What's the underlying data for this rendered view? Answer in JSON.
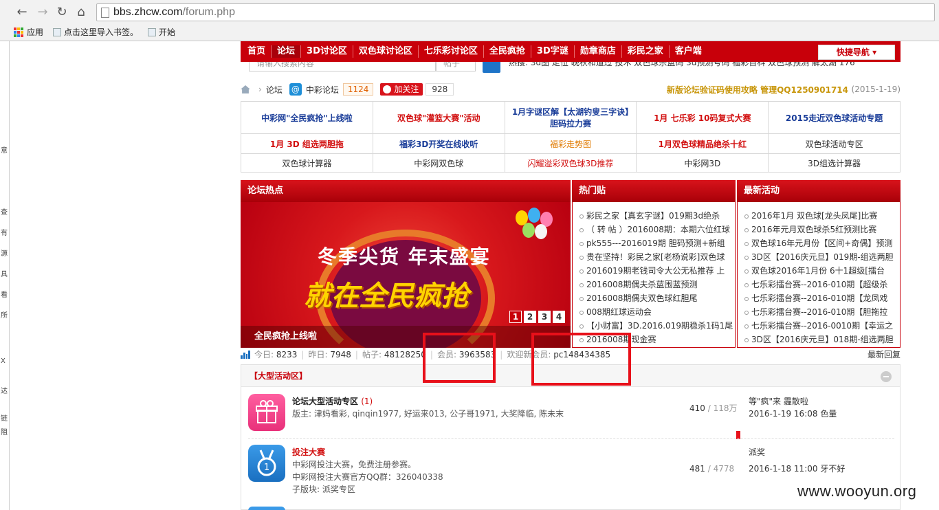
{
  "browser": {
    "back_icon": "back-arrow-icon",
    "url_host": "bbs.zhcw.com",
    "url_path": "/forum.php",
    "bookmarks": [
      "应用",
      "点击这里导入书签。",
      "开始"
    ]
  },
  "site_nav": {
    "items": [
      "首页",
      "论坛",
      "3D讨论区",
      "双色球讨论区",
      "七乐彩讨论区",
      "全民疯抢",
      "3D字谜",
      "勋章商店",
      "彩民之家",
      "客户端"
    ],
    "quick_nav": "快捷导航"
  },
  "search": {
    "placeholder": "请输入搜索内容",
    "type": "帖子",
    "hot_text": "热搜: 3d图 走位 晚秋和道过 技术 双色球杀蓝码 3d预测号码 福彩百科 双色球预测 解太湖 176"
  },
  "crumb": {
    "forum": "论坛",
    "site_name": "中彩论坛",
    "site_count": "1124",
    "follow": "加关注",
    "follow_count": "928",
    "notice": "新版论坛验证码使用攻略 管理QQ1250901714",
    "notice_date": "(2015-1-19)"
  },
  "links": {
    "row1": [
      "中彩网\"全民疯抢\"上线啦",
      "双色球\"灌篮大赛\"活动",
      "1月字谜区解【太湖钓叟三字诀】胆码拉力赛",
      "1月 七乐彩 10码复式大赛",
      "2015走近双色球活动专题"
    ],
    "row2": [
      "1月 3D 组选两胆拖",
      "福彩3D开奖在线收听",
      "福彩走势图",
      "1月双色球精品绝杀十红",
      "双色球活动专区"
    ],
    "row3": [
      "双色球计算器",
      "中彩网双色球",
      "闪耀溢彩双色球3D推荐",
      "中彩网3D",
      "3D组选计算器"
    ]
  },
  "panels": {
    "hot_forum_title": "论坛热点",
    "hot_posts_title": "热门贴",
    "activities_title": "最新活动"
  },
  "banner": {
    "line1": "冬季尖货 年末盛宴",
    "line2": "就在全民疯抢",
    "caption": "全民疯抢上线啦",
    "pages": [
      "1",
      "2",
      "3",
      "4"
    ],
    "current_page": "1"
  },
  "hot_posts": [
    "彩民之家【真玄字谜】019期3d绝杀",
    "（ 转 帖 ）2016008期：本期六位红球",
    "pk555---2016019期 胆码预测+新组",
    "贵在坚持！彩民之家[老杨说彩]双色球",
    "2016019期老钱司令大公无私推荐 上",
    "2016008期偶夫杀蓝围蓝预测",
    "2016008期偶夫双色球红胆尾",
    "008期红球运动会",
    "【小财富】3D.2016.019期稳杀1码1尾",
    "2016008期现金赛"
  ],
  "activities": [
    "2016年1月 双色球[龙头凤尾]比赛",
    "2016年元月双色球杀5红预测比赛",
    "双色球16年元月份【区间+奇偶】预测",
    "3D区【2016庆元旦】019期-组选两胆",
    "双色球2016年1月份 6十1超级[擂台",
    "七乐彩擂台赛--2016-010期【超级杀",
    "七乐彩擂台赛--2016-010期【龙凤戏",
    "七乐彩擂台赛--2016-010期【胆拖拉",
    "七乐彩擂台赛--2016-0010期【幸运之",
    "3D区【2016庆元旦】018期-组选两胆"
  ],
  "stats": {
    "today_label": "今日:",
    "today": "8233",
    "yesterday_label": "昨日:",
    "yesterday": "7948",
    "posts_label": "帖子:",
    "posts": "48128250",
    "members_label": "会员:",
    "members": "3963583",
    "welcome_label": "欢迎新会员:",
    "new_member": "pc148434385",
    "latest_reply": "最新回复"
  },
  "zone": {
    "title": "【大型活动区】",
    "forums": [
      {
        "name": "论坛大型活动专区",
        "new_count": "(1)",
        "moderators": "版主: 津妈看彩, qinqin1977, 好运来013, 公子哥1971, 大奖降临, 陈未末",
        "threads": "410",
        "posts": "118万",
        "last_title": "等\"疯\"来 霾散啦",
        "last_info": "2016-1-19 16:08 色量"
      },
      {
        "name": "投注大赛",
        "desc1": "中彩网投注大赛，免费注册参赛。",
        "desc2": "中彩网投注大赛官方QQ群：326040338",
        "sub": "子版块: 派奖专区",
        "threads": "481",
        "posts": "4778",
        "last_title": "派奖",
        "last_info": "2016-1-18 11:00 牙不好"
      }
    ]
  },
  "watermark": "www.wooyun.org",
  "colors": {
    "brand_red": "#c8000a",
    "highlight_box": "#e8101a",
    "search_blue": "#1e74c8"
  }
}
